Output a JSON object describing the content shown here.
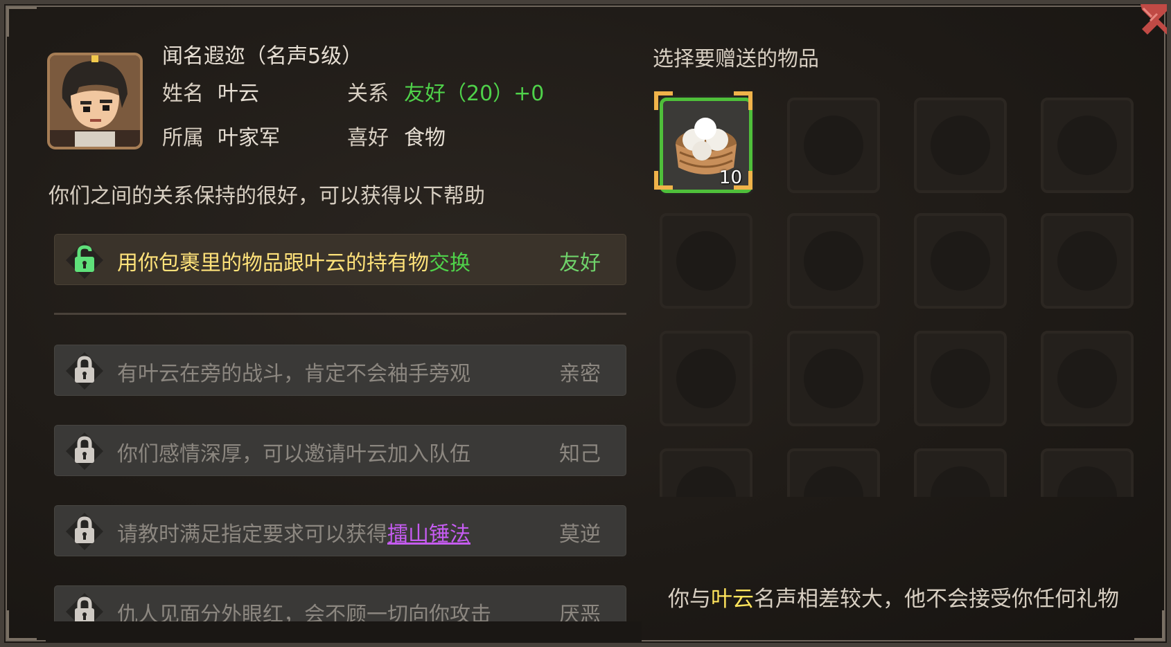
{
  "character": {
    "title": "闻名遐迩（名声5级）",
    "name_label": "姓名",
    "name": "叶云",
    "relation_label": "关系",
    "relation_value": "友好（20）+0",
    "faction_label": "所属",
    "faction": "叶家军",
    "hobby_label": "喜好",
    "hobby": "食物"
  },
  "relationship_summary": "你们之间的关系保持的很好，可以获得以下帮助",
  "help_rows": [
    {
      "desc_prefix": "用你包裹里的物品跟叶云的持有物",
      "desc_highlight": "交换",
      "level": "友好",
      "state": "unlocked",
      "icon": "lock-open-icon"
    },
    {
      "desc": "有叶云在旁的战斗，肯定不会袖手旁观",
      "level": "亲密",
      "state": "locked",
      "icon": "lock-icon"
    },
    {
      "desc": "你们感情深厚，可以邀请叶云加入队伍",
      "level": "知己",
      "state": "locked",
      "icon": "lock-icon"
    },
    {
      "desc_prefix": "请教时满足指定要求可以获得",
      "desc_link": "擂山锤法",
      "level": "莫逆",
      "state": "locked",
      "icon": "lock-icon"
    },
    {
      "desc": "仇人见面分外眼红，会不顾一切向你攻击",
      "level": "厌恶",
      "state": "locked",
      "icon": "lock-icon"
    }
  ],
  "gift": {
    "heading": "选择要赠送的物品",
    "items": [
      {
        "name": "steamed-buns",
        "count": "10",
        "selected": true
      }
    ],
    "note_prefix": "你与",
    "note_name": "叶云",
    "note_suffix": "名声相差较大，他不会接受你任何礼物"
  },
  "colors": {
    "accent_green": "#4fd24a",
    "accent_yellow": "#ffe45c",
    "link_purple": "#c65cf2",
    "locked_text": "#8c8780"
  }
}
